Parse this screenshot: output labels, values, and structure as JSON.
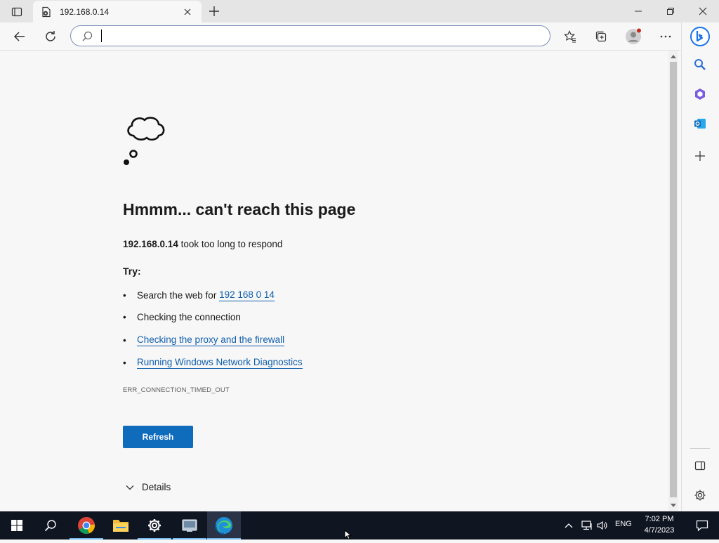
{
  "tab": {
    "title": "192.168.0.14",
    "favicon": "page-error-icon"
  },
  "omnibox": {
    "value": "",
    "placeholder": ""
  },
  "error": {
    "title": "Hmmm... can't reach this page",
    "host": "192.168.0.14",
    "desc_suffix": " took too long to respond",
    "try_label": "Try:",
    "suggestions": {
      "search_prefix": "Search the web for ",
      "search_link": "192 168 0 14",
      "connection": "Checking the connection",
      "proxy": "Checking the proxy and the firewall",
      "diagnostics": "Running Windows Network Diagnostics"
    },
    "code": "ERR_CONNECTION_TIMED_OUT",
    "refresh_label": "Refresh",
    "details_label": "Details"
  },
  "taskbar": {
    "lang": "ENG",
    "time": "7:02 PM",
    "date": "4/7/2023",
    "apps": [
      "start-icon",
      "search-icon",
      "chrome-icon",
      "file-explorer-icon",
      "settings-icon",
      "control-panel-icon",
      "edge-icon"
    ]
  },
  "colors": {
    "accent": "#0f6cbd",
    "link": "#0f5eab",
    "taskbar": "#101522"
  }
}
